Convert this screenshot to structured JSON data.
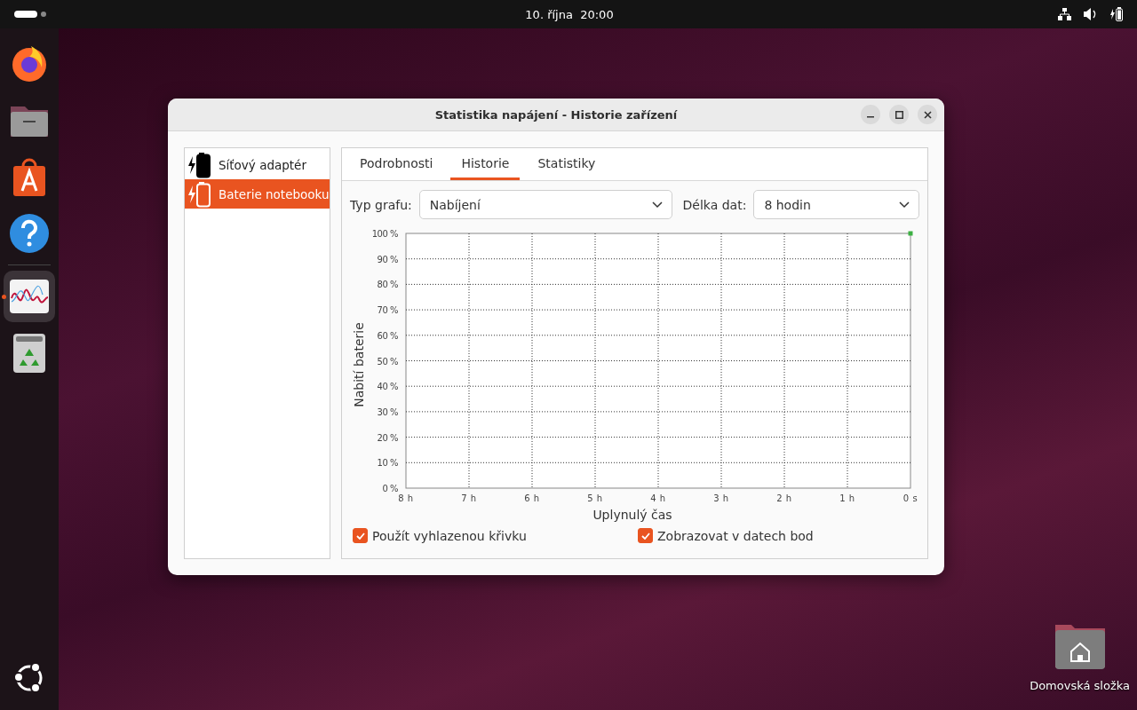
{
  "topbar": {
    "clock": "10. října  20:00"
  },
  "dock": {
    "items": [
      {
        "kind": "browser",
        "active": false
      },
      {
        "kind": "files",
        "active": false
      },
      {
        "kind": "store",
        "active": false
      },
      {
        "kind": "help",
        "active": false
      },
      {
        "kind": "stats",
        "active": true
      },
      {
        "kind": "trash",
        "active": false
      }
    ]
  },
  "window": {
    "title": "Statistika napájení - Historie zařízení",
    "sidebar": {
      "items": [
        {
          "label": "Síťový adaptér",
          "kind": "adapter",
          "selected": false
        },
        {
          "label": "Baterie notebooku",
          "kind": "battery",
          "selected": true
        }
      ]
    },
    "tabs": [
      {
        "label": "Podrobnosti",
        "selected": false
      },
      {
        "label": "Historie",
        "selected": true
      },
      {
        "label": "Statistiky",
        "selected": false
      }
    ],
    "graph_type": {
      "label": "Typ grafu:",
      "value": "Nabíjení"
    },
    "data_length": {
      "label": "Délka dat:",
      "value": "8 hodin"
    },
    "chart_data": {
      "type": "line",
      "xlabel": "Uplynulý čas",
      "ylabel": "Nabití baterie",
      "categories": [
        "8 h",
        "7 h",
        "6 h",
        "5 h",
        "4 h",
        "3 h",
        "2 h",
        "1 h",
        "0 s"
      ],
      "ylim": [
        0,
        100
      ],
      "yticks": [
        {
          "value": 0,
          "label": "0 %"
        },
        {
          "value": 10,
          "label": "10 %"
        },
        {
          "value": 20,
          "label": "20 %"
        },
        {
          "value": 30,
          "label": "30 %"
        },
        {
          "value": 40,
          "label": "40 %"
        },
        {
          "value": 50,
          "label": "50 %"
        },
        {
          "value": 60,
          "label": "60 %"
        },
        {
          "value": 70,
          "label": "70 %"
        },
        {
          "value": 80,
          "label": "80 %"
        },
        {
          "value": 90,
          "label": "90 %"
        },
        {
          "value": 100,
          "label": "100 %"
        }
      ],
      "grid": true,
      "series": [
        {
          "color": "#3cb043",
          "marker": true,
          "values": [
            null,
            null,
            null,
            null,
            null,
            null,
            null,
            null,
            100
          ]
        }
      ]
    },
    "options": [
      {
        "label": "Použít vyhlazenou křivku",
        "checked": true
      },
      {
        "label": "Zobrazovat v datech bod",
        "checked": true
      }
    ]
  },
  "desktop_icons": [
    {
      "label": "Domovská složka"
    }
  ]
}
